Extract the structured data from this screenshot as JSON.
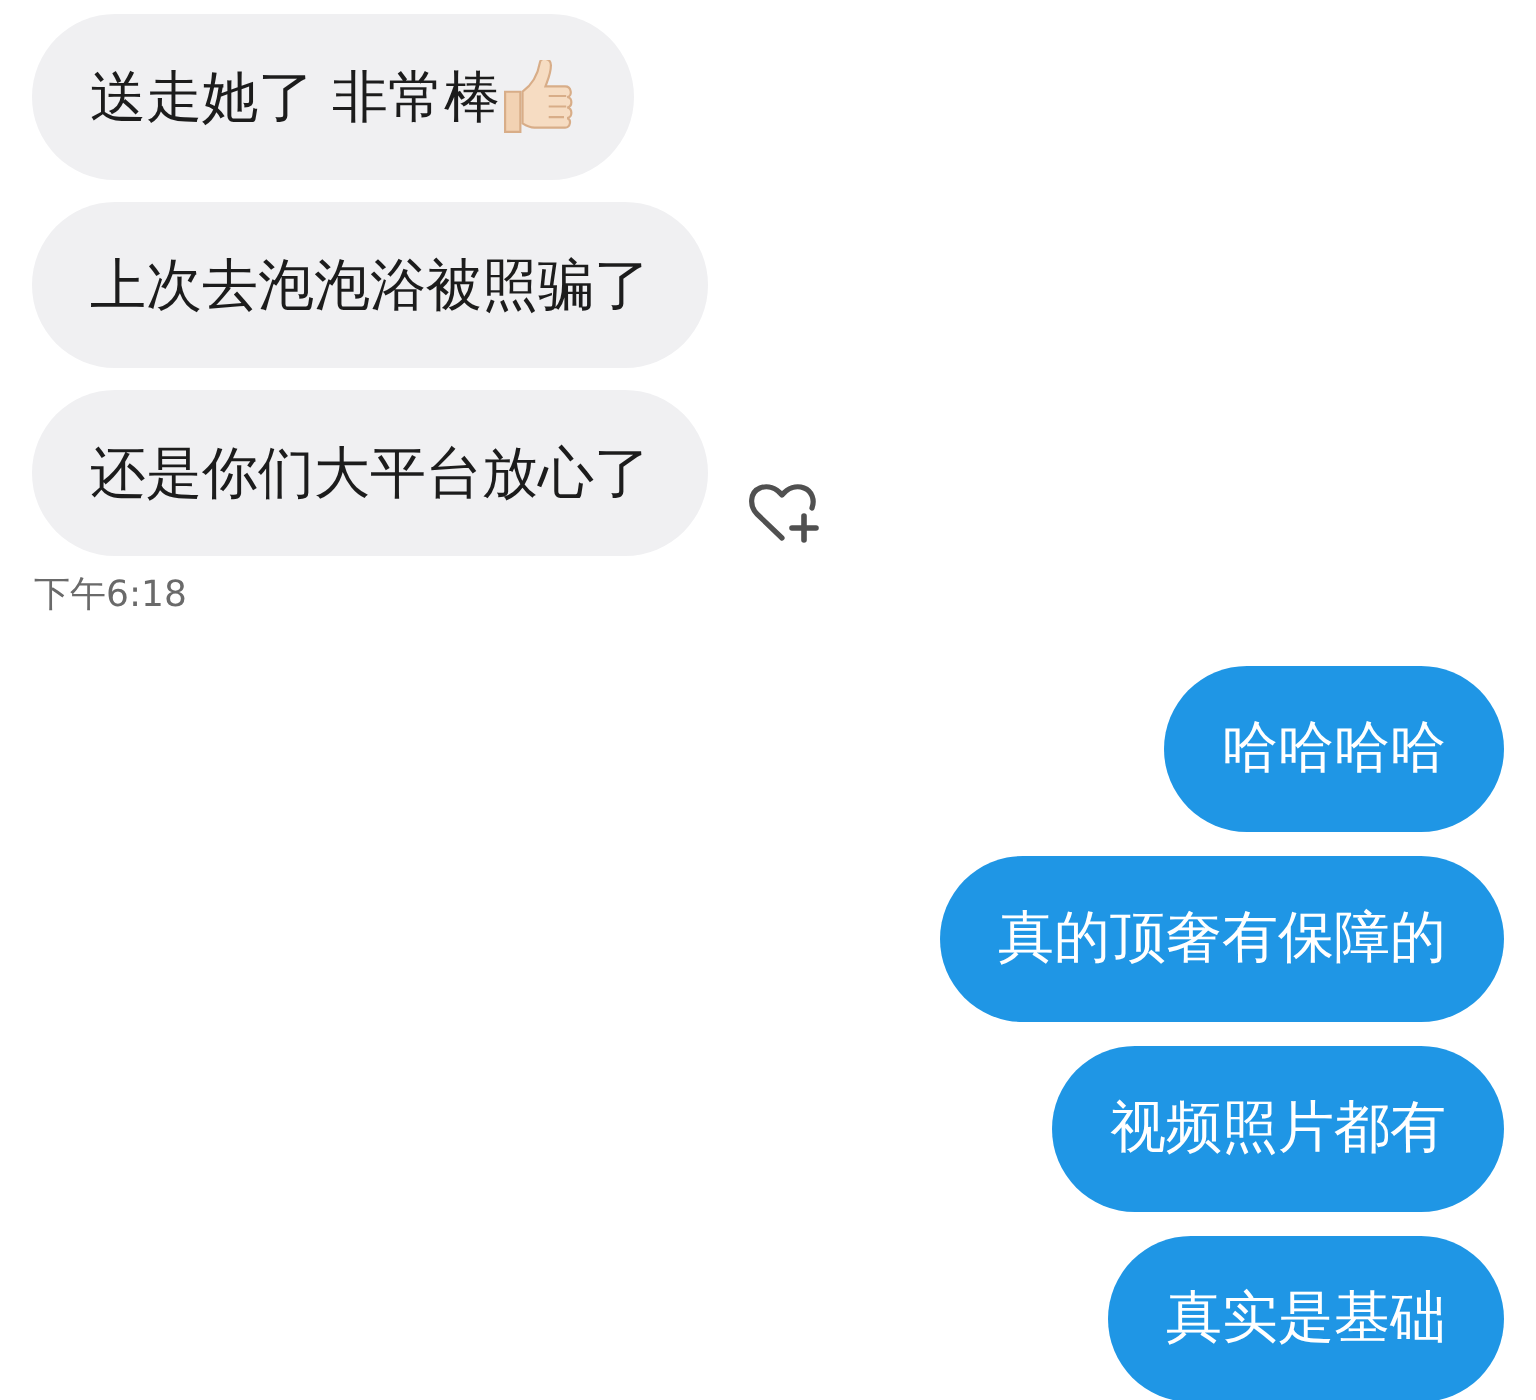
{
  "incoming": {
    "messages": [
      {
        "text": "送走她了 非常棒",
        "thumbs_up": true
      },
      {
        "text": "上次去泡泡浴被照骗了",
        "thumbs_up": false
      },
      {
        "text": "还是你们大平台放心了",
        "thumbs_up": false
      }
    ],
    "time": "下午6:18"
  },
  "outgoing": {
    "messages": [
      {
        "text": "哈哈哈哈"
      },
      {
        "text": "真的顶奢有保障的"
      },
      {
        "text": "视频照片都有"
      },
      {
        "text": "真实是基础"
      }
    ]
  }
}
